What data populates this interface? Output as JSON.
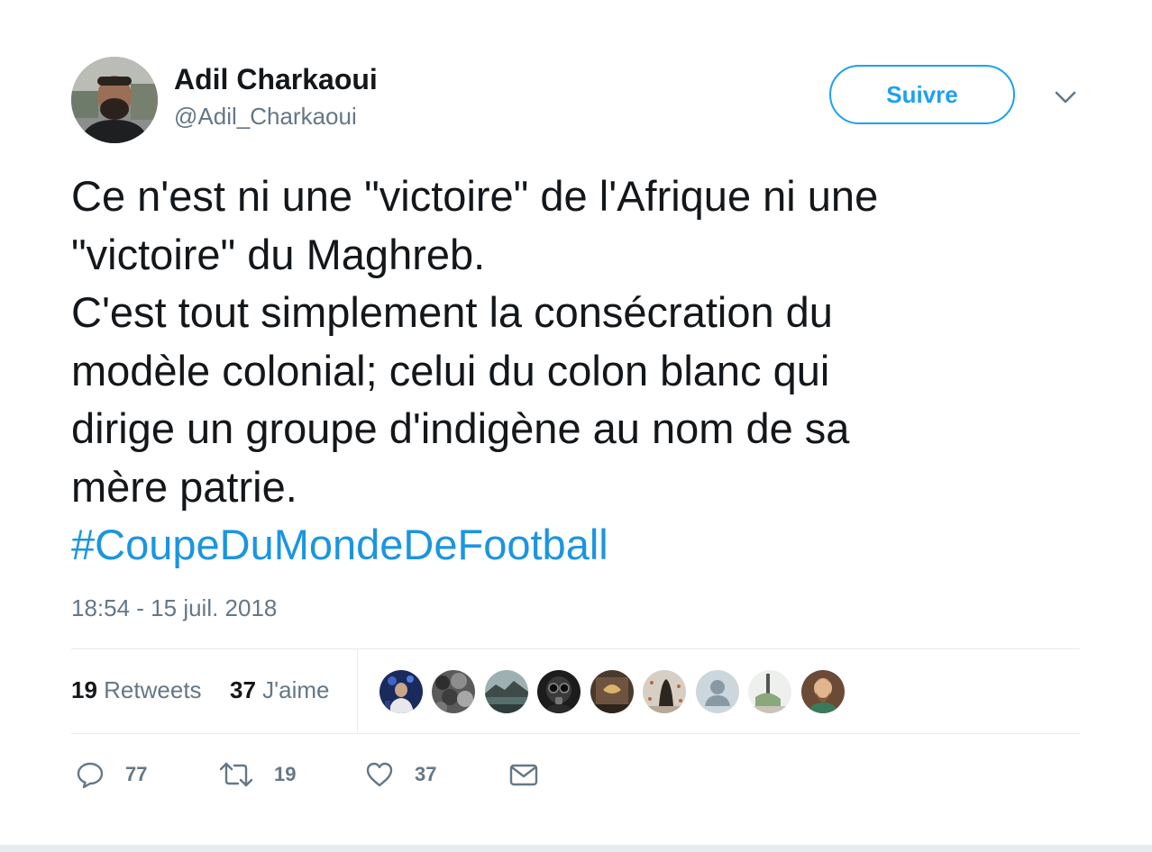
{
  "author": {
    "name": "Adil Charkaoui",
    "handle": "@Adil_Charkaoui",
    "avatar_icon": "user-avatar-photo"
  },
  "follow_button": {
    "label": "Suivre"
  },
  "menu": {
    "icon": "chevron-down-icon"
  },
  "tweet": {
    "lines": [
      "Ce n'est ni une \"victoire\" de l'Afrique ni une",
      "\"victoire\" du Maghreb.",
      "C'est tout simplement la consécration du",
      "modèle colonial; celui du colon blanc qui",
      "dirige un groupe d'indigène au nom de sa",
      "mère patrie."
    ],
    "hashtag": "#CoupeDuMondeDeFootball",
    "timestamp": "18:54 - 15 juil. 2018"
  },
  "stats": {
    "retweets_count": "19",
    "retweets_label": "Retweets",
    "likes_count": "37",
    "likes_label": "J'aime"
  },
  "likers": [
    {
      "icon": "liker-avatar-1"
    },
    {
      "icon": "liker-avatar-2"
    },
    {
      "icon": "liker-avatar-3"
    },
    {
      "icon": "liker-avatar-4"
    },
    {
      "icon": "liker-avatar-5"
    },
    {
      "icon": "liker-avatar-6"
    },
    {
      "icon": "default-user-avatar"
    },
    {
      "icon": "liker-avatar-8"
    },
    {
      "icon": "liker-avatar-9"
    }
  ],
  "actions": {
    "reply_count": "77",
    "retweet_count": "19",
    "like_count": "37"
  },
  "colors": {
    "accent": "#1da1f2",
    "hashtag": "#1b95e0",
    "secondary_text": "#657786",
    "primary_text": "#14171a",
    "divider": "#e6ecf0"
  }
}
